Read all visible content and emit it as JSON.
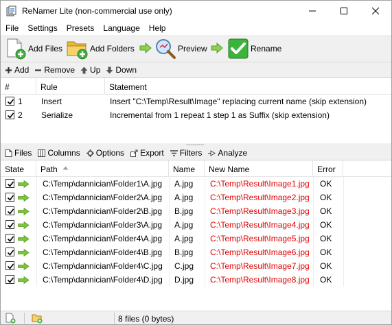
{
  "window": {
    "title": "ReNamer Lite (non-commercial use only)"
  },
  "menu": [
    "File",
    "Settings",
    "Presets",
    "Language",
    "Help"
  ],
  "toolbar": {
    "add_files": "Add Files",
    "add_folders": "Add Folders",
    "preview": "Preview",
    "rename": "Rename"
  },
  "rules_toolbar": {
    "add": "Add",
    "remove": "Remove",
    "up": "Up",
    "down": "Down"
  },
  "rules": {
    "headers": [
      "#",
      "Rule",
      "Statement"
    ],
    "rows": [
      {
        "checked": true,
        "num": "1",
        "rule": "Insert",
        "statement": "Insert \"C:\\Temp\\Result\\Image\" replacing current name (skip extension)"
      },
      {
        "checked": true,
        "num": "2",
        "rule": "Serialize",
        "statement": "Incremental from 1 repeat 1 step 1 as Suffix (skip extension)"
      }
    ]
  },
  "files_toolbar": {
    "files": "Files",
    "columns": "Columns",
    "options": "Options",
    "export": "Export",
    "filters": "Filters",
    "analyze": "Analyze"
  },
  "files": {
    "headers": [
      "State",
      "Path",
      "Name",
      "New Name",
      "Error"
    ],
    "sorted_column": "Path",
    "rows": [
      {
        "checked": true,
        "path": "C:\\Temp\\dannician\\Folder1\\A.jpg",
        "name": "A.jpg",
        "new_name": "C:\\Temp\\Result\\Image1.jpg",
        "error": "OK"
      },
      {
        "checked": true,
        "path": "C:\\Temp\\dannician\\Folder2\\A.jpg",
        "name": "A.jpg",
        "new_name": "C:\\Temp\\Result\\Image2.jpg",
        "error": "OK"
      },
      {
        "checked": true,
        "path": "C:\\Temp\\dannician\\Folder2\\B.jpg",
        "name": "B.jpg",
        "new_name": "C:\\Temp\\Result\\Image3.jpg",
        "error": "OK"
      },
      {
        "checked": true,
        "path": "C:\\Temp\\dannician\\Folder3\\A.jpg",
        "name": "A.jpg",
        "new_name": "C:\\Temp\\Result\\Image4.jpg",
        "error": "OK"
      },
      {
        "checked": true,
        "path": "C:\\Temp\\dannician\\Folder4\\A.jpg",
        "name": "A.jpg",
        "new_name": "C:\\Temp\\Result\\Image5.jpg",
        "error": "OK"
      },
      {
        "checked": true,
        "path": "C:\\Temp\\dannician\\Folder4\\B.jpg",
        "name": "B.jpg",
        "new_name": "C:\\Temp\\Result\\Image6.jpg",
        "error": "OK"
      },
      {
        "checked": true,
        "path": "C:\\Temp\\dannician\\Folder4\\C.jpg",
        "name": "C.jpg",
        "new_name": "C:\\Temp\\Result\\Image7.jpg",
        "error": "OK"
      },
      {
        "checked": true,
        "path": "C:\\Temp\\dannician\\Folder4\\D.jpg",
        "name": "D.jpg",
        "new_name": "C:\\Temp\\Result\\Image8.jpg",
        "error": "OK"
      }
    ]
  },
  "status": {
    "file_count": "8 files (0 bytes)"
  },
  "colors": {
    "new_name_text": "#e00000",
    "state_arrow": "#7cc53a",
    "rename_icon": "#3cb33c"
  },
  "icons": {
    "app": "app-icon",
    "add_files": "add-files-icon",
    "add_folders": "add-folders-icon",
    "preview": "preview-magnifier-icon",
    "rename": "rename-checkmark-icon",
    "flow_arrow": "arrow-right-icon",
    "state": "arrow-right-icon"
  }
}
